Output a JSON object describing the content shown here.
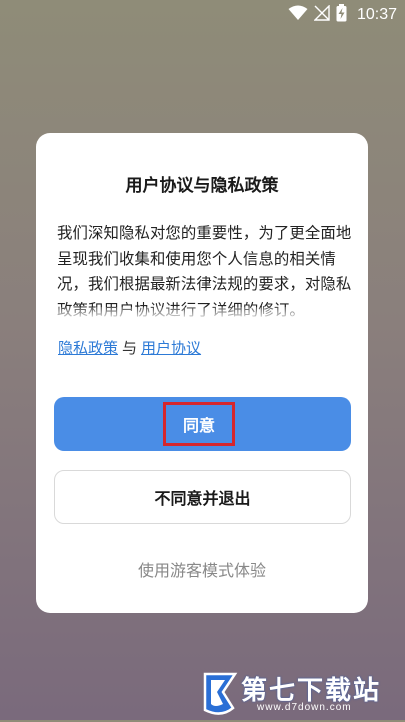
{
  "status_bar": {
    "time": "10:37",
    "icons": [
      "wifi-icon",
      "no-signal-icon",
      "battery-charging-icon"
    ]
  },
  "dialog": {
    "title": "用户协议与隐私政策",
    "body": "我们深知隐私对您的重要性，为了更全面地呈现我们收集和使用您个人信息的相关情况，我们根据最新法律法规的要求，对隐私政策和用户协议进行了详细的修订。",
    "privacy_link": "隐私政策",
    "separator": "与",
    "user_agreement_link": "用户协议",
    "agree_button": "同意",
    "disagree_button": "不同意并退出",
    "guest_mode": "使用游客模式体验"
  },
  "watermark": {
    "text": "第七下载站",
    "url": "www.d7down.com"
  },
  "colors": {
    "accent": "#4a8de6",
    "link": "#2d7ad6",
    "highlight_border": "#d6262d"
  }
}
